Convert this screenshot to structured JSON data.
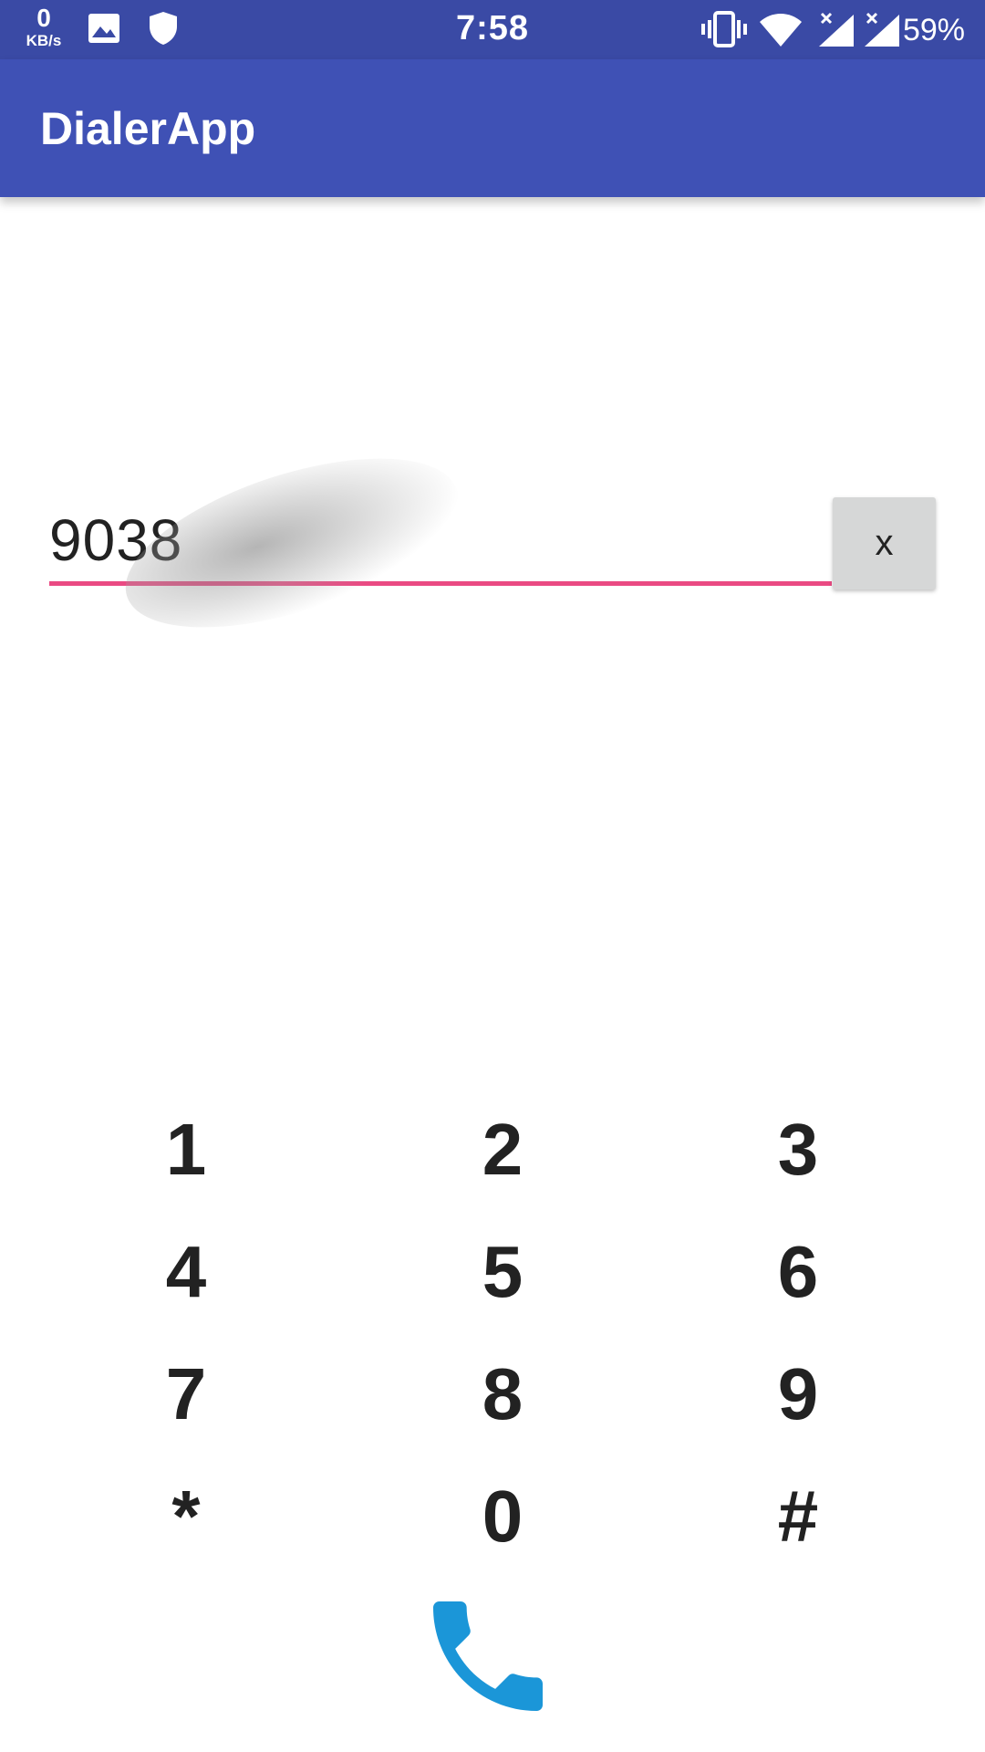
{
  "status_bar": {
    "net_speed_value": "0",
    "net_speed_unit": "KB/s",
    "time": "7:58",
    "battery": "59%",
    "icons": [
      "image-icon",
      "shield-icon",
      "vibrate-icon",
      "wifi-icon",
      "signal-icon",
      "signal-icon"
    ]
  },
  "app_bar": {
    "title": "DialerApp",
    "color": "#3f51b5",
    "status_color": "#3a4aa5"
  },
  "number_input": {
    "value": "9038",
    "underline_color": "#ea4a83"
  },
  "clear_button": {
    "label": "x"
  },
  "keypad": {
    "keys": [
      "1",
      "2",
      "3",
      "4",
      "5",
      "6",
      "7",
      "8",
      "9",
      "*",
      "0",
      "#"
    ]
  },
  "call_button": {
    "icon": "phone-icon",
    "color": "#1b96d8"
  }
}
